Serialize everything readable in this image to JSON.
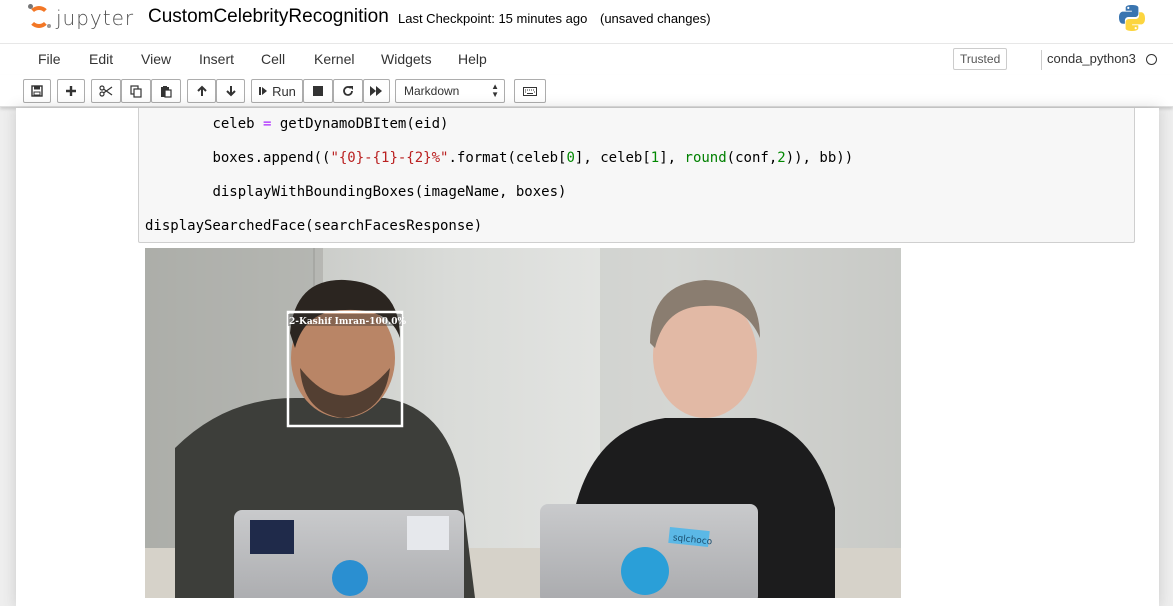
{
  "header": {
    "logo_text": "jupyter",
    "notebook_name": "CustomCelebrityRecognition",
    "checkpoint": "Last Checkpoint: 15 minutes ago",
    "autosave_status": "(unsaved changes)"
  },
  "menubar": {
    "items": [
      "File",
      "Edit",
      "View",
      "Insert",
      "Cell",
      "Kernel",
      "Widgets",
      "Help"
    ],
    "trusted_label": "Trusted",
    "kernel_name": "conda_python3"
  },
  "toolbar": {
    "run_label": "Run",
    "cell_type": "Markdown"
  },
  "cell": {
    "lines": [
      {
        "indent": "        ",
        "tokens": [
          [
            "",
            "celeb "
          ],
          [
            "kw",
            "="
          ],
          [
            "",
            " getDynamoDBItem(eid)"
          ]
        ]
      },
      {
        "indent": "        ",
        "tokens": [
          [
            "",
            "boxes.append(("
          ],
          [
            "str",
            "\"{0}-{1}-{2}%\""
          ],
          [
            "",
            ".format(celeb["
          ],
          [
            "num",
            "0"
          ],
          [
            "",
            "], celeb["
          ],
          [
            "num",
            "1"
          ],
          [
            "",
            "], "
          ],
          [
            "bi",
            "round"
          ],
          [
            "",
            "(conf,"
          ],
          [
            "num",
            "2"
          ],
          [
            "",
            ")), bb))"
          ]
        ]
      },
      {
        "indent": "        ",
        "tokens": [
          [
            "",
            "displayWithBoundingBoxes(imageName, boxes)"
          ]
        ]
      },
      {
        "indent": "",
        "tokens": [
          [
            "",
            "displaySearchedFace(searchFacesResponse)"
          ]
        ]
      }
    ]
  },
  "output": {
    "bounding_box_label": "2-Kashif Imran-100.0%",
    "sticker_text": "sqlchoco"
  },
  "colors": {
    "jupyter_orange": "#f37726",
    "code_bg": "#f7f7f7",
    "keyword": "#aa22ff",
    "string": "#ba2121",
    "number": "#008800"
  }
}
